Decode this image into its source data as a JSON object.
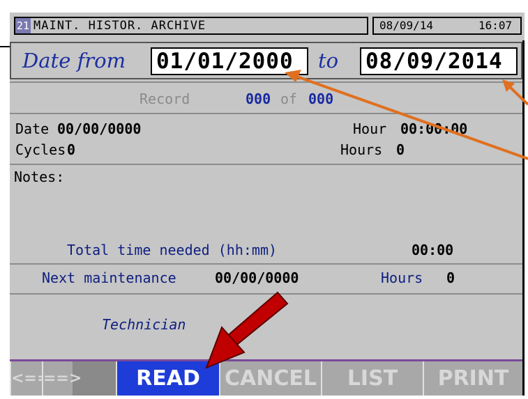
{
  "header": {
    "screen_number": "21",
    "title": "MAINT. HISTOR. ARCHIVE",
    "date": "08/09/14",
    "time": "16:07"
  },
  "filter": {
    "from_label": "Date from",
    "from_value": "01/01/2000",
    "to_label": "to",
    "to_value": "08/09/2014"
  },
  "record": {
    "label": "Record",
    "current": "000",
    "of_label": "of",
    "total": "000"
  },
  "details": {
    "date_label": "Date",
    "date_value": "00/00/0000",
    "hour_label": "Hour",
    "hour_value": "00:00:00",
    "cycles_label": "Cycles",
    "cycles_value": "0",
    "hours_label": "Hours",
    "hours_value": "0",
    "notes_label": "Notes:",
    "total_time_label": "Total time needed (hh:mm)",
    "total_time_value": "00:00",
    "next_maint_label": "Next maintenance",
    "next_maint_value": "00/00/0000",
    "next_hours_label": "Hours",
    "next_hours_value": "0",
    "technician_label": "Technician"
  },
  "softkeys": {
    "prev": "<==",
    "next": "==>",
    "read": "READ",
    "cancel": "CANCEL",
    "list": "LIST",
    "print": "PRINT"
  },
  "colors": {
    "panel_bg": "#c6c6c6",
    "active_key": "#1e3cd8",
    "label_blue": "#1a2aa0",
    "annotation_orange": "#e07020",
    "annotation_red": "#c00000"
  }
}
